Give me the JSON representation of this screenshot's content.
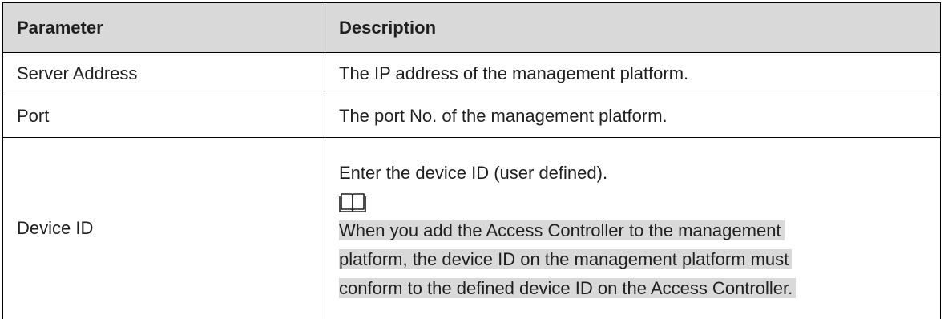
{
  "table": {
    "headers": [
      "Parameter",
      "Description"
    ],
    "rows": [
      {
        "parameter": "Server Address",
        "description": "The IP address of the management platform."
      },
      {
        "parameter": "Port",
        "description": "The port No. of the management platform."
      },
      {
        "parameter": "Device ID",
        "description": "Enter the device ID (user defined).",
        "note_icon": "book-icon",
        "note_lines": [
          "When you add the Access Controller to the management",
          "platform, the device ID on the management platform must",
          "conform to the defined device ID on the Access Controller."
        ]
      }
    ]
  },
  "colors": {
    "header_bg": "#d9d9d9",
    "note_highlight": "#d9d9d9"
  }
}
